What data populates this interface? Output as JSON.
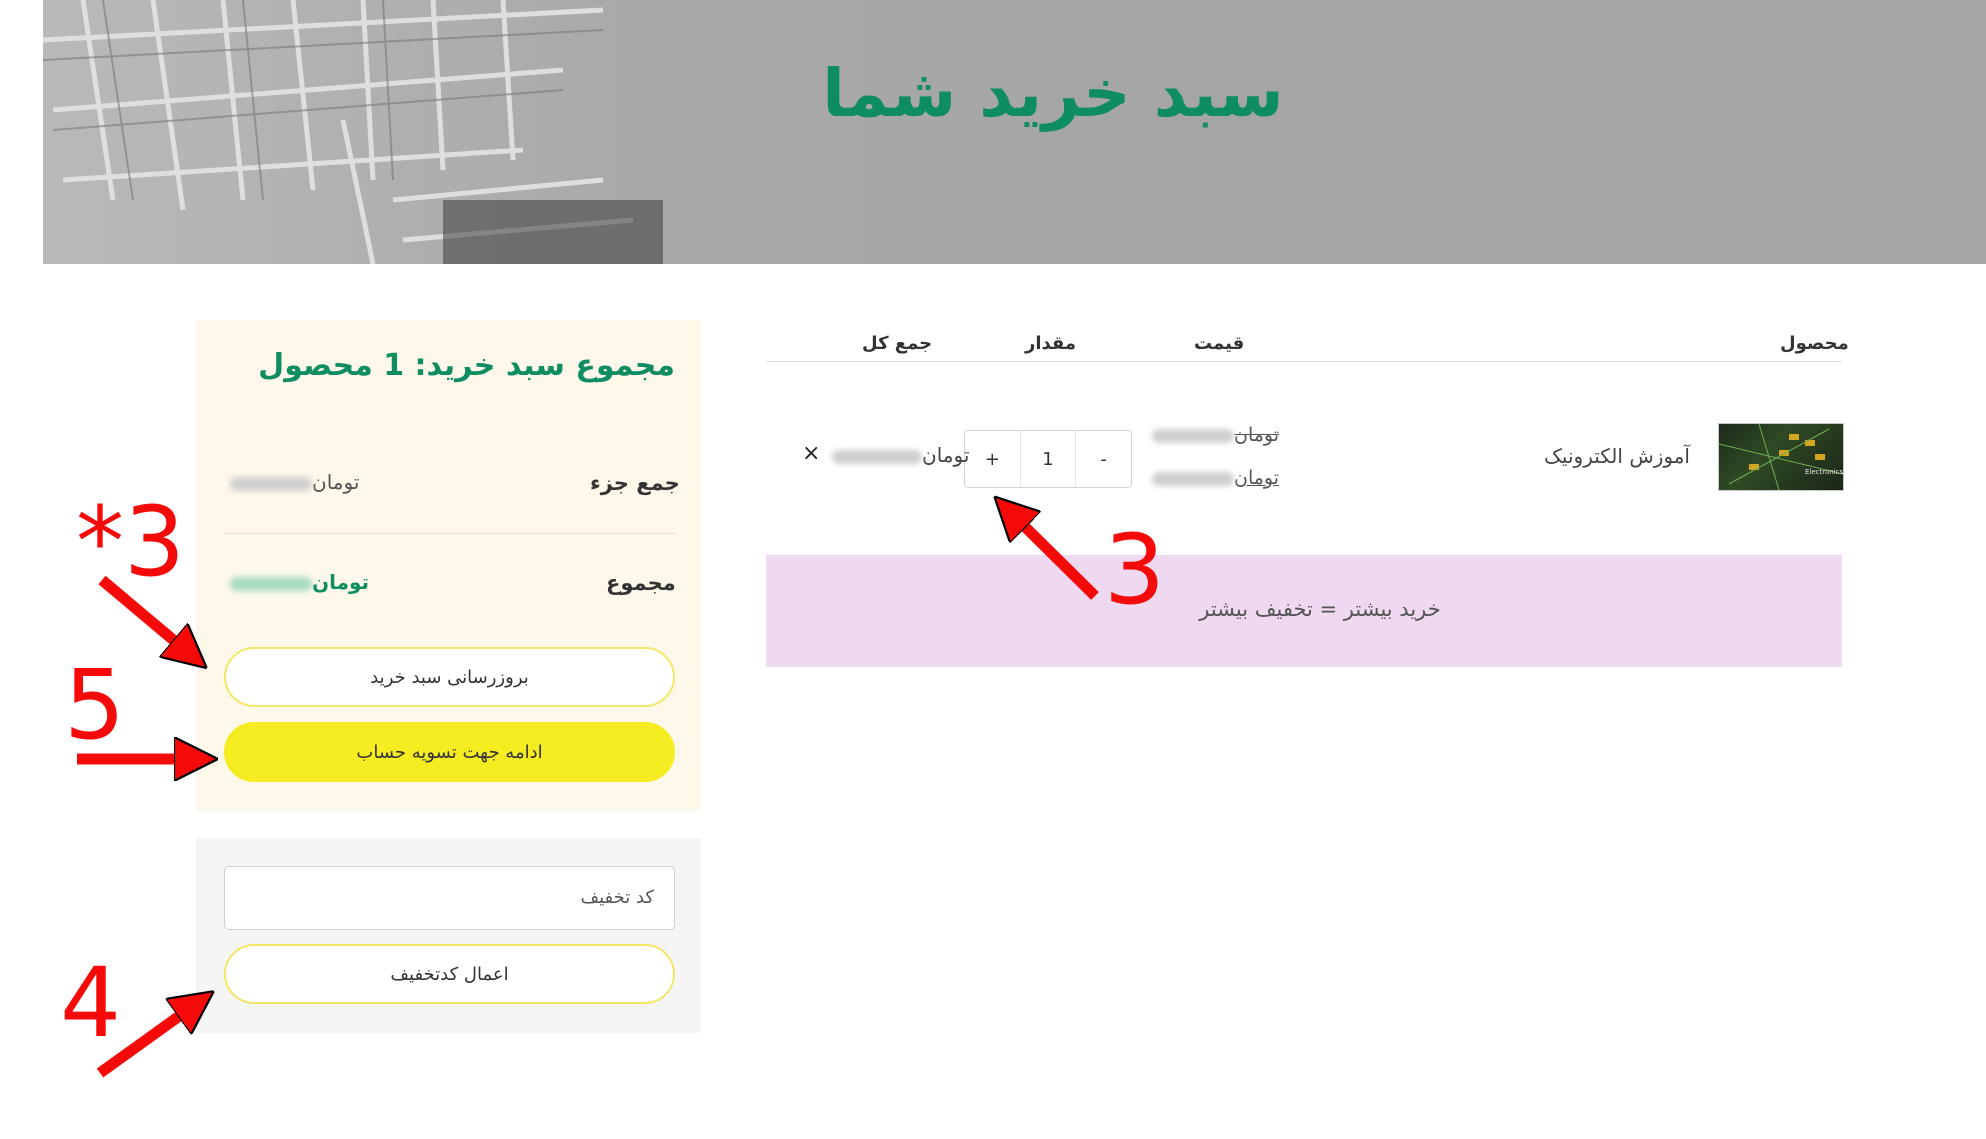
{
  "hero": {
    "title": "سبد خرید شما"
  },
  "table": {
    "headers": {
      "product": "محصول",
      "price": "قیمت",
      "quantity": "مقدار",
      "total": "جمع کل"
    },
    "row": {
      "name": "آموزش الکترونیک",
      "price_old_currency": "تومان",
      "price_new_currency": "تومان",
      "qty_minus": "-",
      "qty_value": "1",
      "qty_plus": "+",
      "total_currency": "تومان",
      "remove": "×"
    }
  },
  "promo": {
    "text": "خرید بیشتر = تخفیف بیشتر"
  },
  "totals": {
    "title": "مجموع سبد خرید: 1 محصول",
    "subtotal_label": "جمع جزء",
    "subtotal_currency": "تومان",
    "total_label": "مجموع",
    "total_currency": "تومان",
    "update_button": "بروزرسانی سبد خرید",
    "checkout_button": "ادامه جهت تسویه حساب"
  },
  "coupon": {
    "placeholder": "کد تخفیف",
    "apply_button": "اعمال کدتخفیف"
  },
  "annotations": {
    "qty_marker": "3",
    "update_marker": "*3",
    "checkout_marker": "5",
    "coupon_marker": "4"
  },
  "colors": {
    "accent_green": "#0e8c62",
    "checkout_yellow": "#f5ec22",
    "promo_bg": "#efd9f0",
    "annotation_red": "#f50a0a"
  }
}
